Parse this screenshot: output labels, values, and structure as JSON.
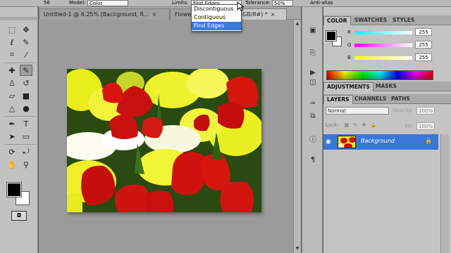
{
  "options_bar": {
    "size_value": "56",
    "model_label": "Model:",
    "model_value": "Color",
    "limits_label": "Limits:",
    "limits_value": "Find Edges",
    "tolerance_label": "Tolerance:",
    "tolerance_value": "50%",
    "anti_alias_label": "Anti-alias"
  },
  "limits_dropdown": {
    "options": [
      "Discontiguous",
      "Contiguous",
      "Find Edges"
    ],
    "selected_index": 2
  },
  "document_tabs": [
    {
      "title": "Untitled-1 @ 6.25% (Background, R...",
      "close": "×",
      "active": false
    },
    {
      "title": "Flowe",
      "close": "",
      "active": false
    },
    {
      "title": "GB/8#) *",
      "close": "×",
      "active": true
    }
  ],
  "color_panel": {
    "tabs": [
      "COLOR",
      "SWATCHES",
      "STYLES"
    ],
    "channels": [
      {
        "label": "R",
        "value": "255",
        "color": "#ff2b2b"
      },
      {
        "label": "G",
        "value": "255",
        "color": "#2bff2b"
      },
      {
        "label": "B",
        "value": "255",
        "color": "#2b6bff"
      }
    ]
  },
  "adjustments_panel": {
    "tabs": [
      "ADJUSTMENTS",
      "MASKS"
    ]
  },
  "layers_panel": {
    "tabs": [
      "LAYERS",
      "CHANNELS",
      "PATHS"
    ],
    "blend_mode": "Normal",
    "opacity_label": "Opacity:",
    "opacity_value": "100%",
    "lock_label": "Lock:",
    "fill_label": "Fill:",
    "fill_value": "100%",
    "layer_name": "Background"
  },
  "toolbox": {
    "quickmask_label": "◘"
  },
  "colors": {
    "selection_blue": "#3a7ad9",
    "panel_gray": "#c4c4c4"
  }
}
